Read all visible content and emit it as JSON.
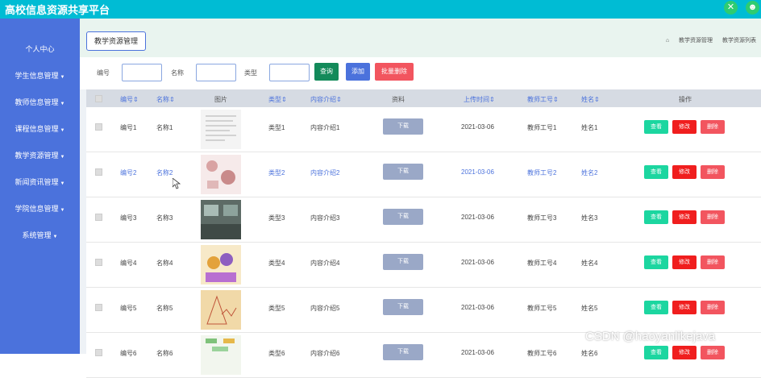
{
  "app": {
    "title": "高校信息资源共享平台"
  },
  "sidebar": {
    "items": [
      {
        "label": "个人中心",
        "caret": false
      },
      {
        "label": "学生信息管理",
        "caret": true
      },
      {
        "label": "教师信息管理",
        "caret": true
      },
      {
        "label": "课程信息管理",
        "caret": true
      },
      {
        "label": "教学资源管理",
        "caret": true
      },
      {
        "label": "新闻资讯管理",
        "caret": true
      },
      {
        "label": "学院信息管理",
        "caret": true
      },
      {
        "label": "系统管理",
        "caret": true
      }
    ]
  },
  "tab": {
    "label": "教学资源管理"
  },
  "breadcrumb": {
    "item1": "教学资源管理",
    "item2": "教学资源列表"
  },
  "search": {
    "label_no": "编号",
    "label_name": "名称",
    "label_type": "类型",
    "btn_query": "查询",
    "btn_add": "添加",
    "btn_batch_delete": "批量删除"
  },
  "table": {
    "headers": {
      "no": "编号",
      "name": "名称",
      "image": "图片",
      "type": "类型",
      "intro": "内容介绍",
      "material": "资料",
      "upload_time": "上传时间",
      "teacher_no": "教师工号",
      "teacher_name": "姓名",
      "ops": "操作"
    },
    "download_label": "下载",
    "view_label": "查看",
    "edit_label": "修改",
    "delete_label": "删除",
    "rows": [
      {
        "no": "编号1",
        "name": "名称1",
        "type": "类型1",
        "intro": "内容介绍1",
        "time": "2021-03-06",
        "teacher_no": "教师工号1",
        "teacher_name": "姓名1"
      },
      {
        "no": "编号2",
        "name": "名称2",
        "type": "类型2",
        "intro": "内容介绍2",
        "time": "2021-03-06",
        "teacher_no": "教师工号2",
        "teacher_name": "姓名2"
      },
      {
        "no": "编号3",
        "name": "名称3",
        "type": "类型3",
        "intro": "内容介绍3",
        "time": "2021-03-06",
        "teacher_no": "教师工号3",
        "teacher_name": "姓名3"
      },
      {
        "no": "编号4",
        "name": "名称4",
        "type": "类型4",
        "intro": "内容介绍4",
        "time": "2021-03-06",
        "teacher_no": "教师工号4",
        "teacher_name": "姓名4"
      },
      {
        "no": "编号5",
        "name": "名称5",
        "type": "类型5",
        "intro": "内容介绍5",
        "time": "2021-03-06",
        "teacher_no": "教师工号5",
        "teacher_name": "姓名5"
      },
      {
        "no": "编号6",
        "name": "名称6",
        "type": "类型6",
        "intro": "内容介绍6",
        "time": "2021-03-06",
        "teacher_no": "教师工号6",
        "teacher_name": "姓名6"
      }
    ]
  },
  "watermark": "CSDN @haoyanlikejava",
  "colors": {
    "topbar": "#00bcd4",
    "sidebar": "#4b72dc",
    "view": "#1cd6a0",
    "edit": "#f01e1e",
    "delete": "#f2555f"
  }
}
